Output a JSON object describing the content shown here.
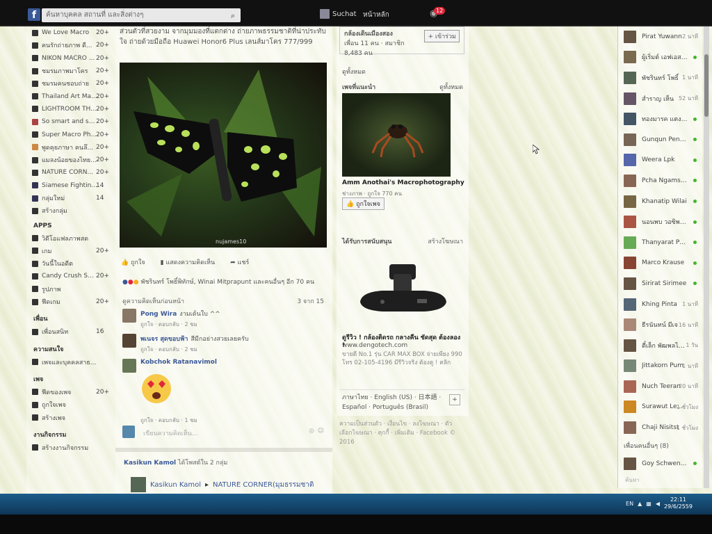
{
  "topbar": {
    "logo": "f",
    "search_placeholder": "ค้นหาบุคคล สถานที่ และสิ่งต่างๆ",
    "user_name": "Suchat",
    "home_label": "หน้าหลัก",
    "notification_count": "12"
  },
  "left": {
    "groups": [
      {
        "label": "We Love Macro",
        "count": "20+"
      },
      {
        "label": "คนรักถ่ายภาพ ดี...",
        "count": "20+"
      },
      {
        "label": "NIKON MACRO ...",
        "count": "20+"
      },
      {
        "label": "ชมรมภาพมาโคร",
        "count": "20+"
      },
      {
        "label": "ชมรมคนชอบถ่าย",
        "count": "20+"
      },
      {
        "label": "Thailand Art Ma...",
        "count": "20+"
      },
      {
        "label": "LIGHTROOM TH...",
        "count": "20+"
      },
      {
        "label": "So smart and sexy",
        "count": "20+"
      },
      {
        "label": "Super Macro Ph...",
        "count": "20+"
      },
      {
        "label": "พูดคุยภาษา คนลึ...",
        "count": "20+"
      },
      {
        "label": "แมลงน้อยของไทย (...",
        "count": "20+"
      },
      {
        "label": "NATURE CORN...",
        "count": "20+"
      },
      {
        "label": "Siamese Fightin...",
        "count": "14"
      },
      {
        "label": "กลุ่มใหม่",
        "count": "14"
      },
      {
        "label": "สร้างกลุ่ม",
        "count": ""
      }
    ],
    "apps_header": "APPS",
    "apps": [
      {
        "label": "วิดีโอแฟลภาพสด",
        "count": ""
      },
      {
        "label": "เกม",
        "count": "20+"
      },
      {
        "label": "วันนี้ในอดีต",
        "count": ""
      },
      {
        "label": "Candy Crush Saga",
        "count": "20+"
      },
      {
        "label": "รูปภาพ",
        "count": ""
      },
      {
        "label": "ฟีดเกม",
        "count": "20+"
      }
    ],
    "friends_header": "เพื่อน",
    "friends": [
      {
        "label": "เพื่อนสนิท",
        "count": "16"
      }
    ],
    "interests_header": "ความสนใจ",
    "interests": [
      {
        "label": "เพจและบุคคลสาธ...",
        "count": ""
      }
    ],
    "pages_header": "เพจ",
    "pages": [
      {
        "label": "ฟีดของเพจ",
        "count": "20+"
      },
      {
        "label": "ถูกใจเพจ",
        "count": ""
      },
      {
        "label": "สร้างเพจ",
        "count": ""
      }
    ],
    "events_header": "งานกิจกรรม",
    "events": [
      {
        "label": "สร้างงานกิจกรรม",
        "count": ""
      }
    ]
  },
  "post": {
    "text": "ส่วนตัวที่สวยงาม จากมุมมองที่แตกต่าง ถ่ายภาพธรรมชาติที่น่าประทับใจ ถ่ายด้วยมือถือ Huawei Honor6 Plus เลนส์มาโคร 777/999",
    "photo_credit": "nujames10",
    "like_label": "ถูกใจ",
    "comment_label": "แสดงความคิดเห็น",
    "share_label": "แชร์",
    "reactions_text": "พัชรินทร์ โพธิ์พิทักษ์, Winai Mitprapunt และคนอื่นๆ อีก 70 คน",
    "prev_comments": "ดูความคิดเห็นก่อนหน้า",
    "comments_count": "3 จาก 15",
    "comments": [
      {
        "name": "Pong Wira",
        "text": "งามเด้นใบ ^^",
        "meta": "ถูกใจ · ตอบกลับ · 2 ชม"
      },
      {
        "name": "พเนจร สุดขอบฟ้า",
        "text": "สีมีกอย่างสวยเลยครับ",
        "meta": "ถูกใจ · ตอบกลับ · 2 ชม"
      },
      {
        "name": "Kobchok Ratanavimol",
        "text": "",
        "meta": "ถูกใจ · ตอบกลับ · 1 ชม"
      }
    ],
    "write_placeholder": "เขียนความคิดเห็น..."
  },
  "next_post": {
    "header_name": "Kasikun Kamol",
    "header_rest": "ได้โพสต์ใน 2 กลุ่ม",
    "author": "Kasikun Kamol",
    "arrow": "▸",
    "group": "NATURE CORNER(มุมธรรมชาติ"
  },
  "right": {
    "group_box_text": "กล้องเดินเมืองสอง",
    "group_box_sub": "เพื่อน 11 คน · สมาชิก 8,483 คน",
    "join_label": "+ เข้าร่วม",
    "see_all": "ดูทั้งหมด",
    "liked_pages_header": "เพจที่แนะนำ",
    "liked_pages_see_all": "ดูทั้งหมด",
    "page_name": "Amm Anothai's Macrophotography",
    "page_sub": "ช่างภาพ · ถูกใจ 770 คน",
    "like_page_label": "ถูกใจเพจ",
    "sponsored_header": "ได้รับการสนับสนุน",
    "create_ad": "สร้างโฆษณา",
    "ad_title": "ดูรีวิว ! กล้องติดรถ กลางคืน ชัดสุด ต้องลอง !",
    "ad_url": "www.dengotech.com",
    "ad_desc": "ขายดี No.1 รุ่น CAR MAX BOX จ่ายเพียง 990 โทร 02-105-4196 มีรีวิวจริง ต้องดู ! คลิก",
    "langs": "ภาษาไทย · English (US) · 日本語 · Español · Português (Brasil)",
    "footer": "ความเป็นส่วนตัว · เงื่อนไข · ลงโฆษณา · ตัวเลือกโฆษณา · คุกกี้ · เพิ่มเติม · Facebook © 2016"
  },
  "chat": {
    "contacts": [
      {
        "name": "Pirat Yuwann",
        "status": "2 นาที"
      },
      {
        "name": "ผู้เริ่มต์ เอฟเอสเอส",
        "status": "online"
      },
      {
        "name": "พัชรินทร์ โพธิ์",
        "status": "1 นาที"
      },
      {
        "name": "สำราญ เห็น",
        "status": "52 นาที"
      },
      {
        "name": "ทองมารค แตงมื่ม",
        "status": "online"
      },
      {
        "name": "Gunqun Pengjan",
        "status": "online"
      },
      {
        "name": "Weera Lpk",
        "status": "online"
      },
      {
        "name": "Pcha Ngamsrisan",
        "status": "online"
      },
      {
        "name": "Khanatip Wilai",
        "status": "online"
      },
      {
        "name": "นอนพบ วอซิพไวลี",
        "status": "online"
      },
      {
        "name": "Thanyarat Phod",
        "status": "online"
      },
      {
        "name": "Marco Krause",
        "status": "online"
      },
      {
        "name": "Sirirat Sirimee",
        "status": "online"
      },
      {
        "name": "Khing Pinta",
        "status": "1 นาที"
      },
      {
        "name": "ธีรนันทน์ มีเจ",
        "status": "16 นาที"
      },
      {
        "name": "ตี๋เล็ก พัฒพลไส้ไจ",
        "status": "1 วัน"
      },
      {
        "name": "Jittakorn Pum",
        "status": "1 นาที"
      },
      {
        "name": "Nuch Teeran",
        "status": "20 นาที"
      },
      {
        "name": "Surawut Le...",
        "status": "1 ชั่วโมง"
      },
      {
        "name": "Chaji Nisitst",
        "status": "1 ชั่วโมง"
      }
    ],
    "more_friends_header": "เพื่อนคนอื่นๆ (8)",
    "more_friends": [
      {
        "name": "Goy Schwendener",
        "status": "online"
      }
    ],
    "search_placeholder": "ค้นหา"
  },
  "taskbar": {
    "lang": "EN",
    "time": "22:11",
    "date": "29/6/2559"
  },
  "colors": {
    "facebook_blue": "#3b5998",
    "online_green": "#42b72a",
    "notification_red": "#e0263a",
    "taskbar_blue": "#1c5c8a"
  }
}
